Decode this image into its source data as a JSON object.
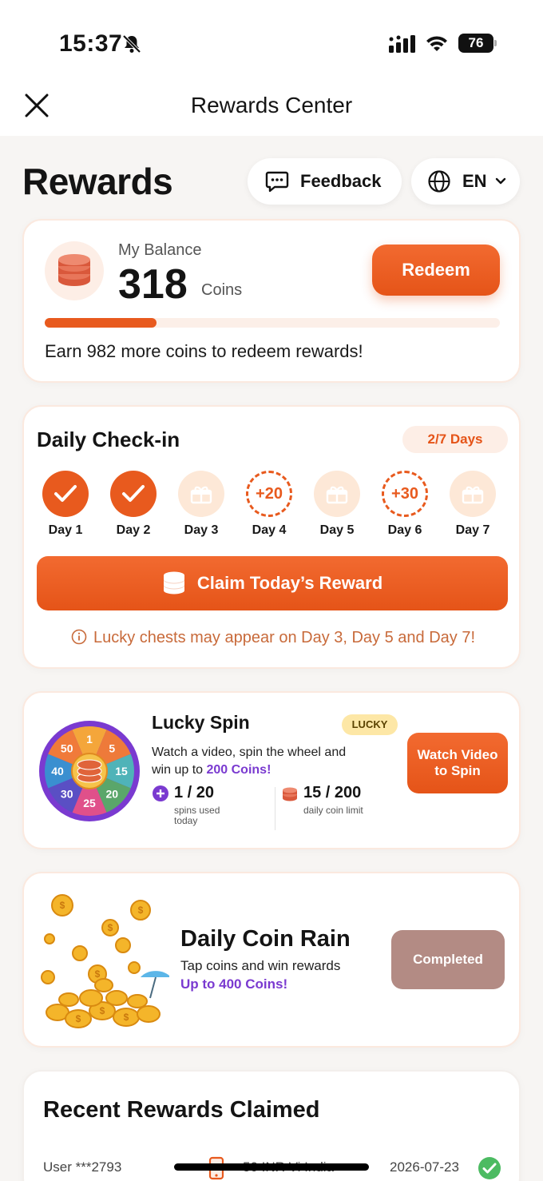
{
  "status_bar": {
    "time": "15:37",
    "battery": "76"
  },
  "nav": {
    "title": "Rewards Center"
  },
  "header": {
    "title": "Rewards",
    "feedback_label": "Feedback",
    "language_label": "EN"
  },
  "balance": {
    "label": "My Balance",
    "value": "318",
    "unit": "Coins",
    "redeem_label": "Redeem",
    "progress_fraction": 0.245,
    "hint": "Earn 982 more coins to redeem rewards!"
  },
  "checkin": {
    "title": "Daily Check-in",
    "badge": "2/7 Days",
    "days": [
      {
        "label": "Day 1",
        "state": "done",
        "icon": "check-icon"
      },
      {
        "label": "Day 2",
        "state": "done",
        "icon": "check-icon"
      },
      {
        "label": "Day 3",
        "state": "chest",
        "icon": "gift-chest-icon"
      },
      {
        "label": "Day 4",
        "state": "bonus",
        "text": "+20"
      },
      {
        "label": "Day 5",
        "state": "chest",
        "icon": "gift-chest-icon"
      },
      {
        "label": "Day 6",
        "state": "bonus",
        "text": "+30"
      },
      {
        "label": "Day 7",
        "state": "chest",
        "icon": "gift-chest-icon"
      }
    ],
    "claim_label": "Claim Today’s Reward",
    "note": "Lucky chests may appear on Day 3, Day 5 and Day 7!"
  },
  "spin": {
    "title": "Lucky Spin",
    "badge": "LUCKY",
    "desc_prefix": "Watch a video, spin the wheel and win up to ",
    "desc_highlight": "200 Coins!",
    "wheel_values": [
      "1",
      "5",
      "15",
      "20",
      "25",
      "30",
      "40",
      "50"
    ],
    "spins_value": "1 / 20",
    "spins_label": "spins used today",
    "coins_value": "15 / 200",
    "coins_label": "daily coin limit",
    "button_label": "Watch Video to Spin"
  },
  "rain": {
    "title": "Daily Coin Rain",
    "desc": "Tap coins and win rewards",
    "highlight": "Up to 400 Coins!",
    "button_label": "Completed"
  },
  "recent": {
    "title": "Recent Rewards Claimed",
    "rows": [
      {
        "user": "User ***2793",
        "item": "50 INR Vi India",
        "date": "2026-07-23"
      }
    ]
  },
  "colors": {
    "accent": "#e85a1e",
    "purple": "#7a3ad0",
    "completed": "#b38b84"
  }
}
